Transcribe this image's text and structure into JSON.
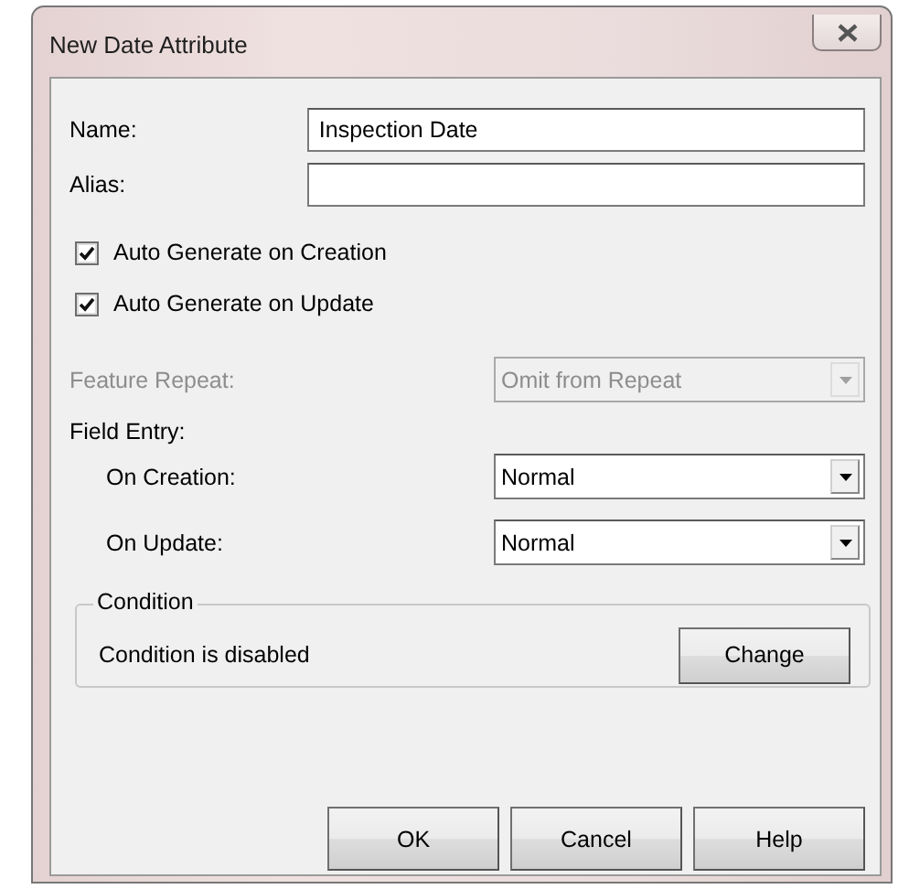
{
  "window": {
    "title": "New Date Attribute"
  },
  "fields": [
    {
      "label": "Name:",
      "value": "Inspection Date"
    },
    {
      "label": "Alias:"
    }
  ],
  "checkboxes": [
    {
      "label": "Auto Generate on Creation",
      "checked": true
    },
    {
      "label": "Auto Generate on Update",
      "checked": true
    }
  ],
  "feature_repeat": {
    "label": "Feature Repeat:",
    "value": "Omit from Repeat",
    "disabled": true
  },
  "field_entry": {
    "heading": "Field Entry:",
    "dropdowns": [
      {
        "label": "On Creation:",
        "value": "Normal",
        "disabled": false
      },
      {
        "label": "On Update:",
        "value": "Normal",
        "disabled": false
      }
    ]
  },
  "condition": {
    "legend": "Condition",
    "text": "Condition is disabled",
    "button": "Change"
  },
  "buttons": [
    "OK",
    "Cancel",
    "Help"
  ]
}
